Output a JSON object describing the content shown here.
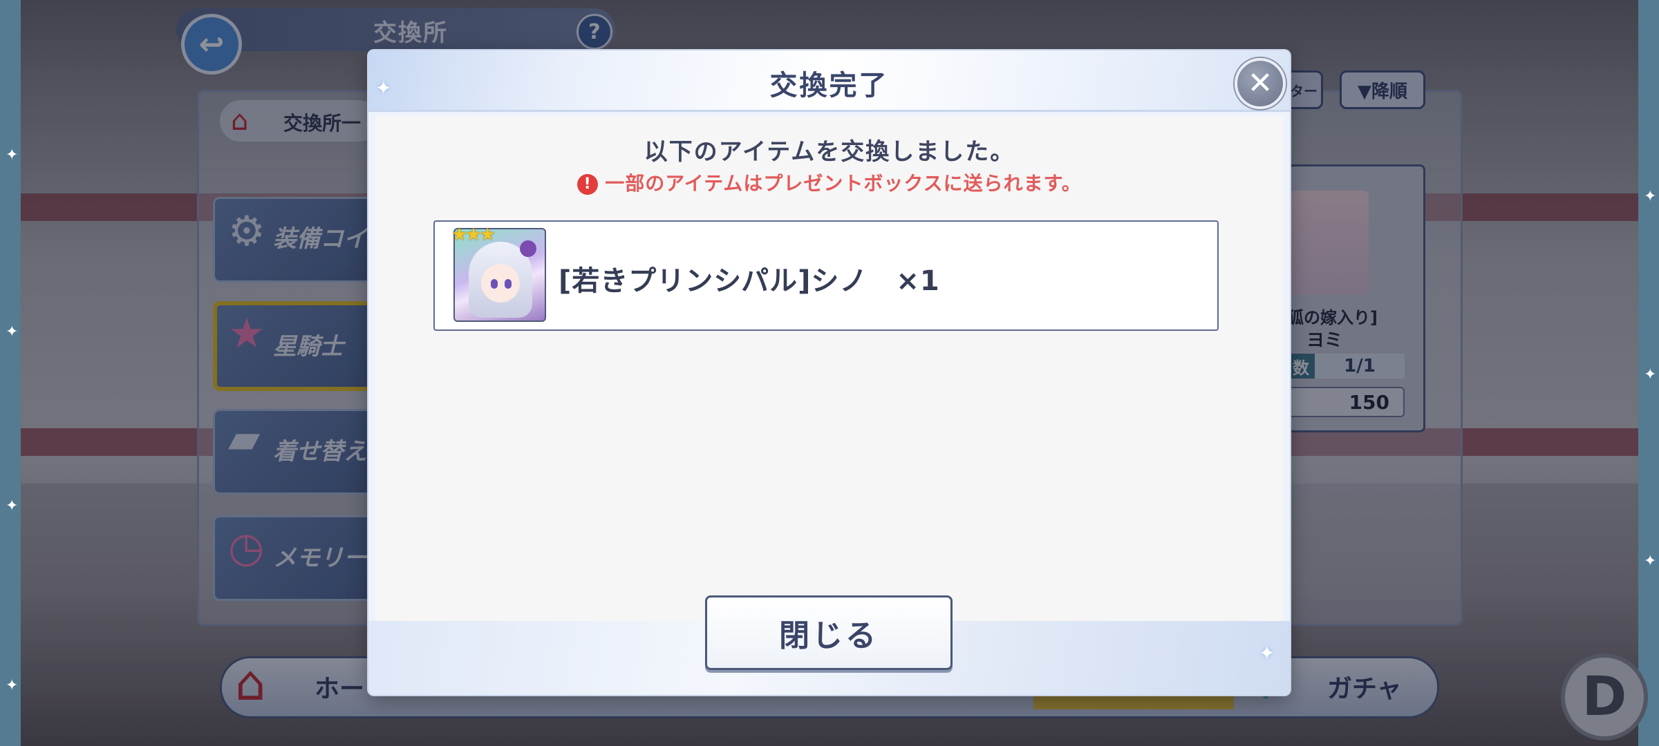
{
  "header": {
    "title": "交換所",
    "back_icon": "↩",
    "help_label": "?"
  },
  "sidebar": {
    "heading": "交換所一",
    "items": [
      {
        "label": "装備コイン",
        "icon": "gear-coin-icon"
      },
      {
        "label": "星騎士",
        "icon": "star-knight-icon"
      },
      {
        "label": "着せ替え",
        "icon": "avatar-icon"
      },
      {
        "label": "メモリーメ",
        "icon": "clock-icon"
      }
    ]
  },
  "shop": {
    "sort_label": "▼降順",
    "filter_label": "ター",
    "card": {
      "name_line1": "狐の嫁入り]",
      "name_line2": "ヨミ",
      "count_label": "数",
      "count_value": "1/1",
      "price": "150"
    }
  },
  "bottom_nav": {
    "home_label": "ホー",
    "gacha_label": "ガチャ"
  },
  "d_button_label": "D",
  "modal": {
    "title": "交換完了",
    "close_icon": "✕",
    "message": "以下のアイテムを交換しました。",
    "warning_icon": "!",
    "warning": "一部のアイテムはプレゼントボックスに送られます。",
    "items": [
      {
        "name": "[若きプリンシパル]シノ　×1",
        "stars": "★★★",
        "rarity": 3
      }
    ],
    "close_button_label": "閉じる"
  },
  "colors": {
    "accent_text": "#39456b",
    "warning": "#e25a5a",
    "star": "#f3c623"
  }
}
